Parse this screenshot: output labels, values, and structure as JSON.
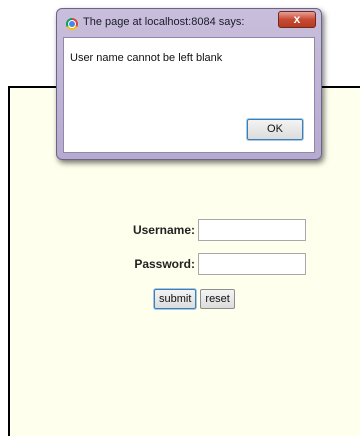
{
  "dialog": {
    "title": "The page at localhost:8084 says:",
    "message": "User name  cannot be left blank",
    "close_label": "x",
    "ok_label": "OK"
  },
  "form": {
    "username_label": "Username:",
    "username_value": "",
    "password_label": "Password:",
    "password_value": "",
    "submit_label": "submit",
    "reset_label": "reset"
  },
  "colors": {
    "panel_background": "#ffffee",
    "panel_border": "#000000",
    "dialog_frame": "#b6aad0",
    "close_button": "#c74a33"
  },
  "icons": {
    "browser": "chrome-icon",
    "close": "close-icon"
  }
}
